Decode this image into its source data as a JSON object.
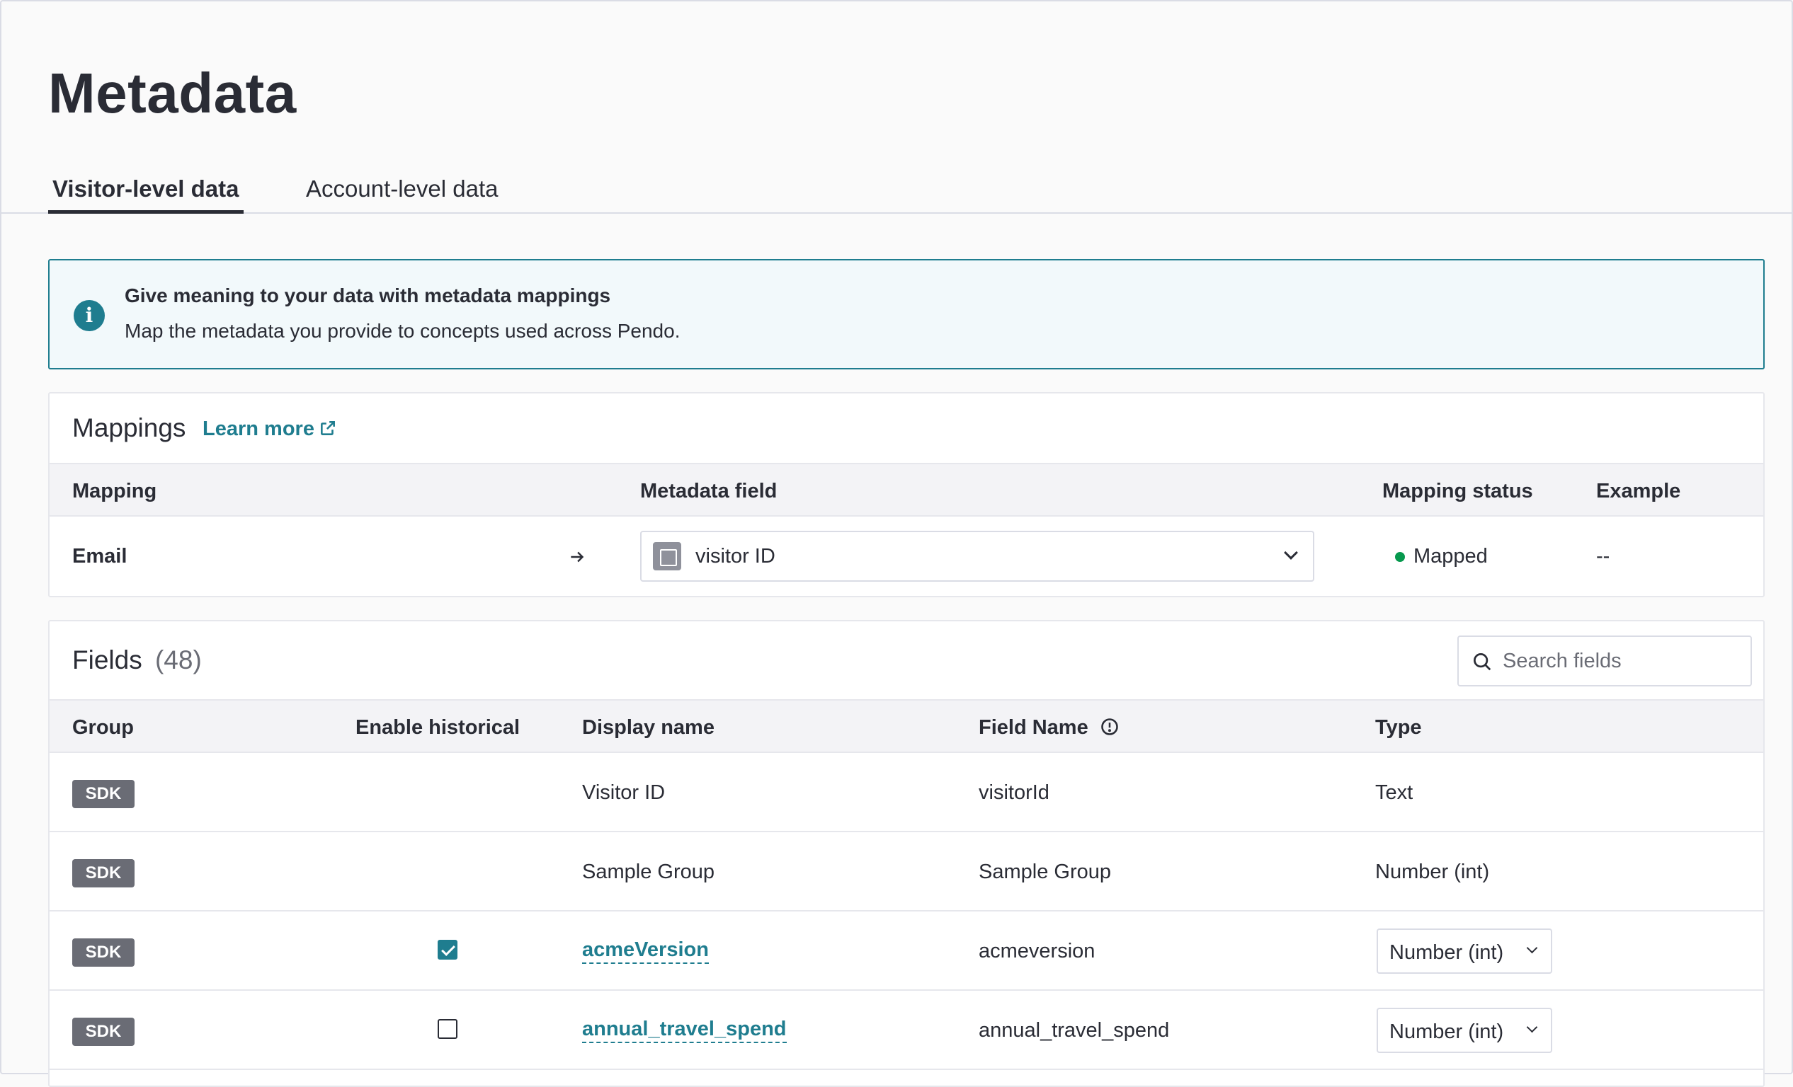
{
  "page": {
    "title": "Metadata"
  },
  "tabs": [
    {
      "label": "Visitor-level data",
      "active": true
    },
    {
      "label": "Account-level data",
      "active": false
    }
  ],
  "banner": {
    "icon": "info-icon",
    "title": "Give meaning to your data with metadata mappings",
    "text": "Map the metadata you provide to concepts used across Pendo."
  },
  "mappings": {
    "title": "Mappings",
    "learn_more": "Learn more",
    "headers": {
      "mapping": "Mapping",
      "metadata_field": "Metadata field",
      "status": "Mapping status",
      "example": "Example"
    },
    "rows": [
      {
        "mapping": "Email",
        "metadata_field": "visitor ID",
        "status": "Mapped",
        "example": "--"
      }
    ]
  },
  "fields": {
    "title": "Fields",
    "count": "(48)",
    "search_placeholder": "Search fields",
    "headers": {
      "group": "Group",
      "enable_historical": "Enable historical",
      "display_name": "Display name",
      "field_name": "Field Name",
      "type": "Type"
    },
    "rows": [
      {
        "group": "SDK",
        "historical": null,
        "display_name": "Visitor ID",
        "field_name": "visitorId",
        "type": "Text",
        "editable": false
      },
      {
        "group": "SDK",
        "historical": null,
        "display_name": "Sample Group",
        "field_name": "Sample Group",
        "type": "Number (int)",
        "editable": false
      },
      {
        "group": "SDK",
        "historical": true,
        "display_name": "acmeVersion",
        "field_name": "acmeversion",
        "type": "Number (int)",
        "editable": true
      },
      {
        "group": "SDK",
        "historical": false,
        "display_name": "annual_travel_spend",
        "field_name": "annual_travel_spend",
        "type": "Number (int)",
        "editable": true
      }
    ]
  },
  "colors": {
    "accent": "#1f7d8f",
    "mapped": "#07994e",
    "badge": "#6a6c75"
  }
}
